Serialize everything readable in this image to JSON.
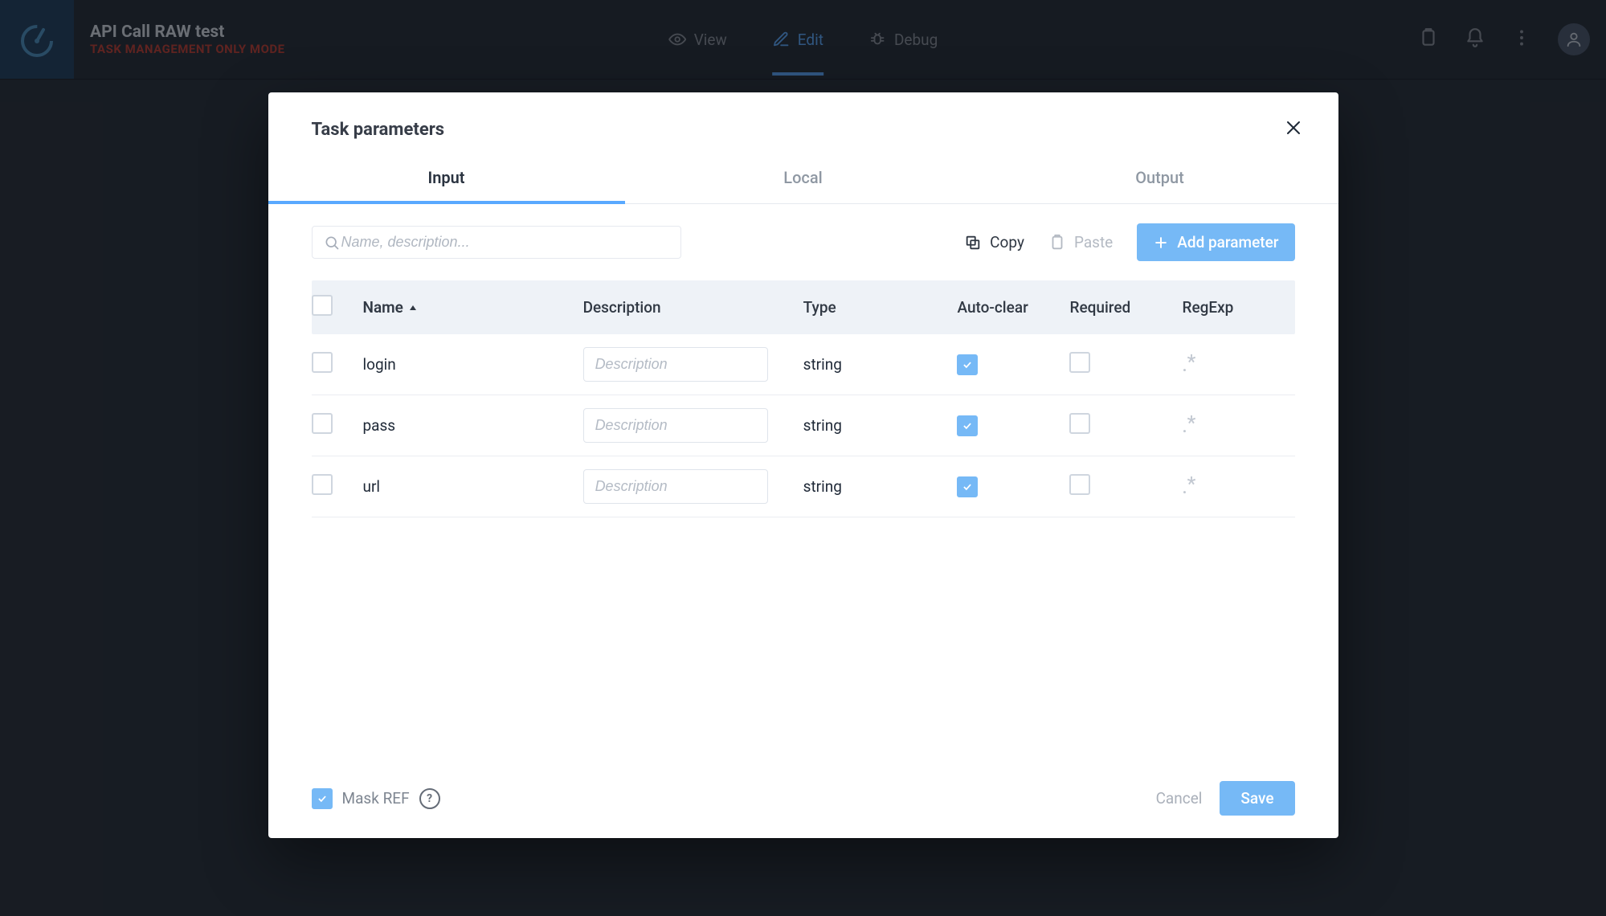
{
  "header": {
    "title": "API Call RAW test",
    "subtitle": "TASK MANAGEMENT ONLY MODE",
    "center_items": [
      {
        "label": "View",
        "active": false
      },
      {
        "label": "Edit",
        "active": true
      },
      {
        "label": "Debug",
        "active": false
      }
    ]
  },
  "modal": {
    "title": "Task parameters",
    "tabs": [
      {
        "label": "Input",
        "active": true
      },
      {
        "label": "Local",
        "active": false
      },
      {
        "label": "Output",
        "active": false
      }
    ],
    "search_placeholder": "Name, description...",
    "toolbar": {
      "copy_label": "Copy",
      "paste_label": "Paste",
      "add_label": "Add parameter"
    },
    "columns": {
      "name": "Name",
      "description": "Description",
      "type": "Type",
      "autoclear": "Auto-clear",
      "required": "Required",
      "regexp": "RegExp"
    },
    "desc_placeholder": "Description",
    "rows": [
      {
        "name": "login",
        "description": "",
        "type": "string",
        "autoclear": true,
        "required": false,
        "regexp": ".*"
      },
      {
        "name": "pass",
        "description": "",
        "type": "string",
        "autoclear": true,
        "required": false,
        "regexp": ".*"
      },
      {
        "name": "url",
        "description": "",
        "type": "string",
        "autoclear": true,
        "required": false,
        "regexp": ".*"
      }
    ],
    "footer": {
      "mask_label": "Mask REF",
      "mask_checked": true,
      "cancel": "Cancel",
      "save": "Save"
    }
  }
}
